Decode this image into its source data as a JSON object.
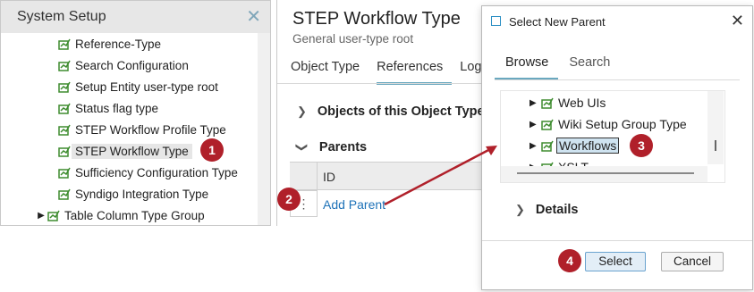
{
  "left_panel": {
    "title": "System Setup",
    "tree": [
      {
        "label": "Reference-Type",
        "expandable": false,
        "selected": false
      },
      {
        "label": "Search Configuration",
        "expandable": false,
        "selected": false
      },
      {
        "label": "Setup Entity user-type root",
        "expandable": false,
        "selected": false
      },
      {
        "label": "Status flag type",
        "expandable": false,
        "selected": false
      },
      {
        "label": "STEP Workflow Profile Type",
        "expandable": false,
        "selected": false
      },
      {
        "label": "STEP Workflow Type",
        "expandable": false,
        "selected": true
      },
      {
        "label": "Sufficiency Configuration Type",
        "expandable": false,
        "selected": false
      },
      {
        "label": "Syndigo Integration Type",
        "expandable": false,
        "selected": false
      },
      {
        "label": "Table Column Type Group",
        "expandable": true,
        "selected": false
      }
    ]
  },
  "main": {
    "title": "STEP Workflow Type",
    "subtitle": "General user-type root",
    "tabs": [
      "Object Type",
      "References",
      "Log"
    ],
    "active_tab": "References",
    "sections": {
      "objects": "Objects of this Object Type",
      "parents": "Parents"
    },
    "grid": {
      "column_id": "ID",
      "row_handle": "⋮"
    },
    "add_parent": "Add Parent"
  },
  "dialog": {
    "title": "Select New Parent",
    "tabs": [
      "Browse",
      "Search"
    ],
    "active_tab": "Browse",
    "tree": [
      {
        "label": "Web UIs",
        "selected": false
      },
      {
        "label": "Wiki Setup Group Type",
        "selected": false
      },
      {
        "label": "Workflows",
        "selected": true
      },
      {
        "label": "XSLT",
        "selected": false
      }
    ],
    "details": "Details",
    "select_button": "Select",
    "cancel_button": "Cancel"
  },
  "callouts": [
    "1",
    "2",
    "3",
    "4"
  ],
  "colors": {
    "callout": "#b0202a",
    "link": "#1e72b8",
    "tab_underline": "#6aa8bf",
    "type_icon": "#3e8c2f"
  },
  "icons": {
    "close": "close-icon",
    "type": "object-type-icon",
    "expand": "triangle-right-icon",
    "chevron": "chevron-right-icon",
    "chevron_down": "chevron-down-icon",
    "window": "window-icon"
  }
}
